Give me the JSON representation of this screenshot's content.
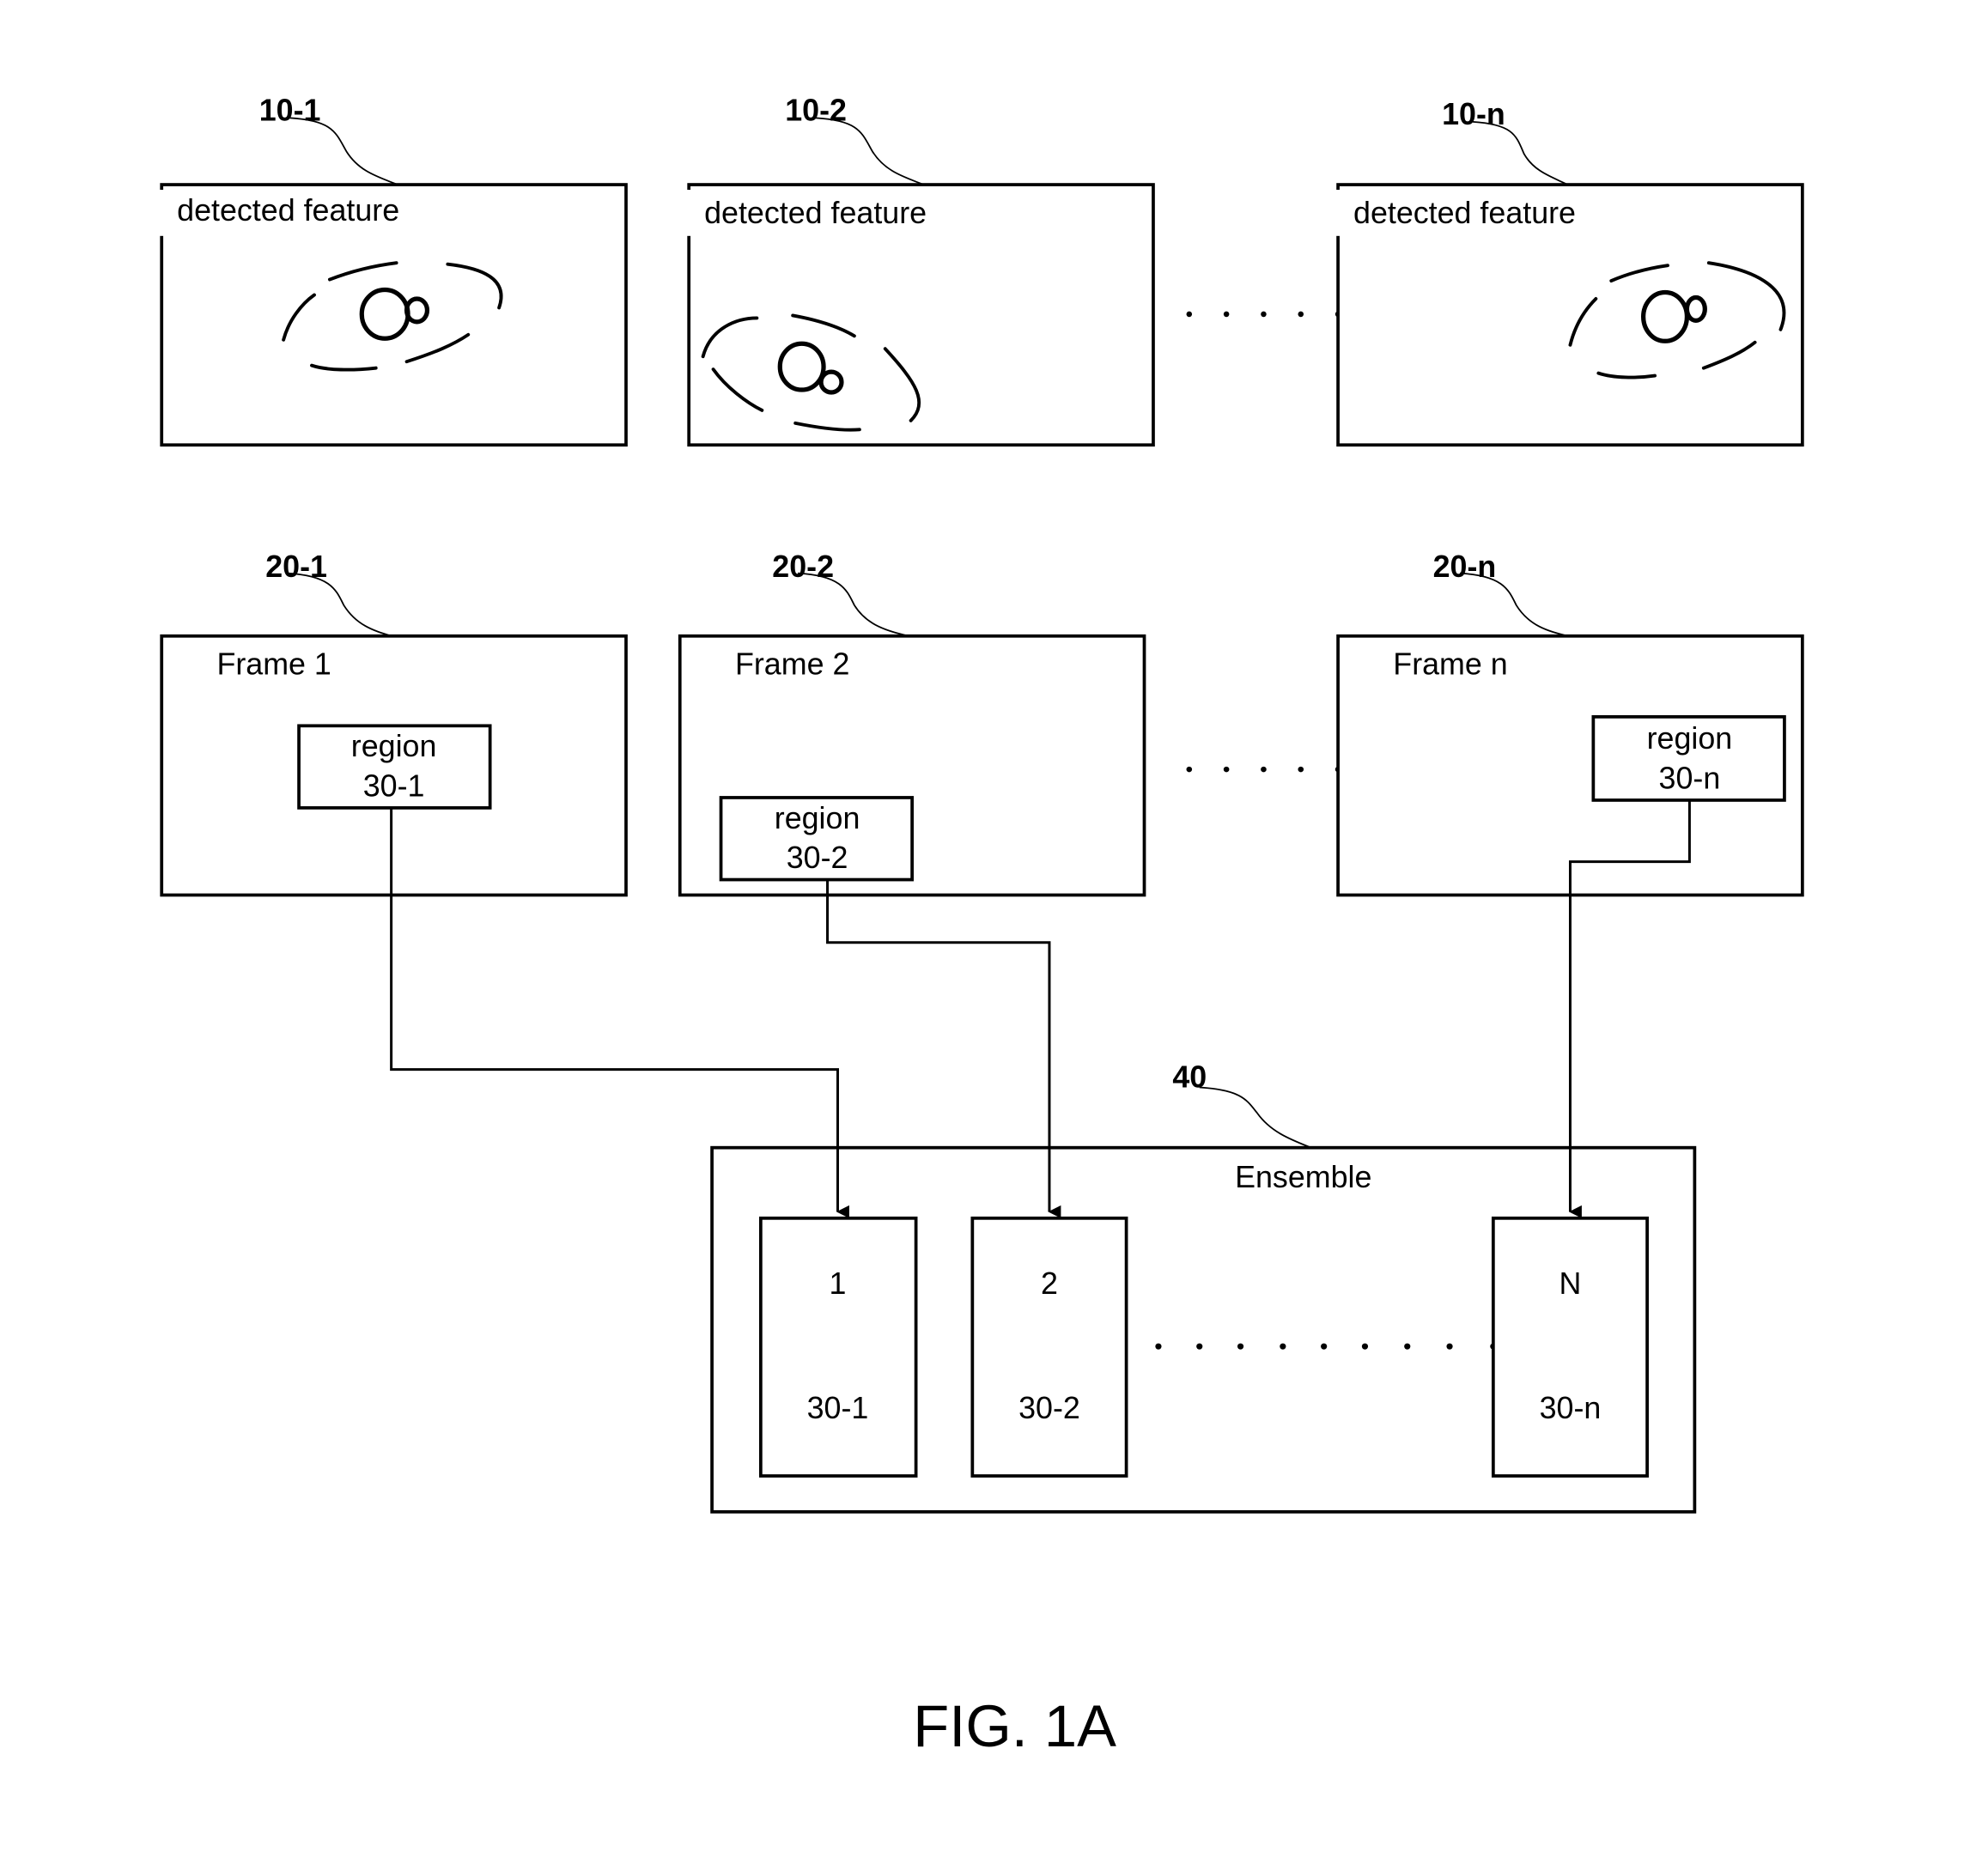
{
  "figure_label": "FIG. 1A",
  "feature_panels": [
    {
      "ref": "10-1",
      "caption": "detected feature",
      "icon": "feature-blob-icon"
    },
    {
      "ref": "10-2",
      "caption": "detected feature",
      "icon": "feature-blob-icon"
    },
    {
      "ref": "10-n",
      "caption": "detected feature",
      "icon": "feature-blob-icon"
    }
  ],
  "frames": [
    {
      "ref": "20-1",
      "title": "Frame 1",
      "region_word": "region",
      "region_id": "30-1"
    },
    {
      "ref": "20-2",
      "title": "Frame 2",
      "region_word": "region",
      "region_id": "30-2"
    },
    {
      "ref": "20-n",
      "title": "Frame n",
      "region_word": "region",
      "region_id": "30-n"
    }
  ],
  "ensemble": {
    "ref": "40",
    "title": "Ensemble",
    "members": [
      {
        "index": "1",
        "region_id": "30-1"
      },
      {
        "index": "2",
        "region_id": "30-2"
      },
      {
        "index": "N",
        "region_id": "30-n"
      }
    ]
  }
}
